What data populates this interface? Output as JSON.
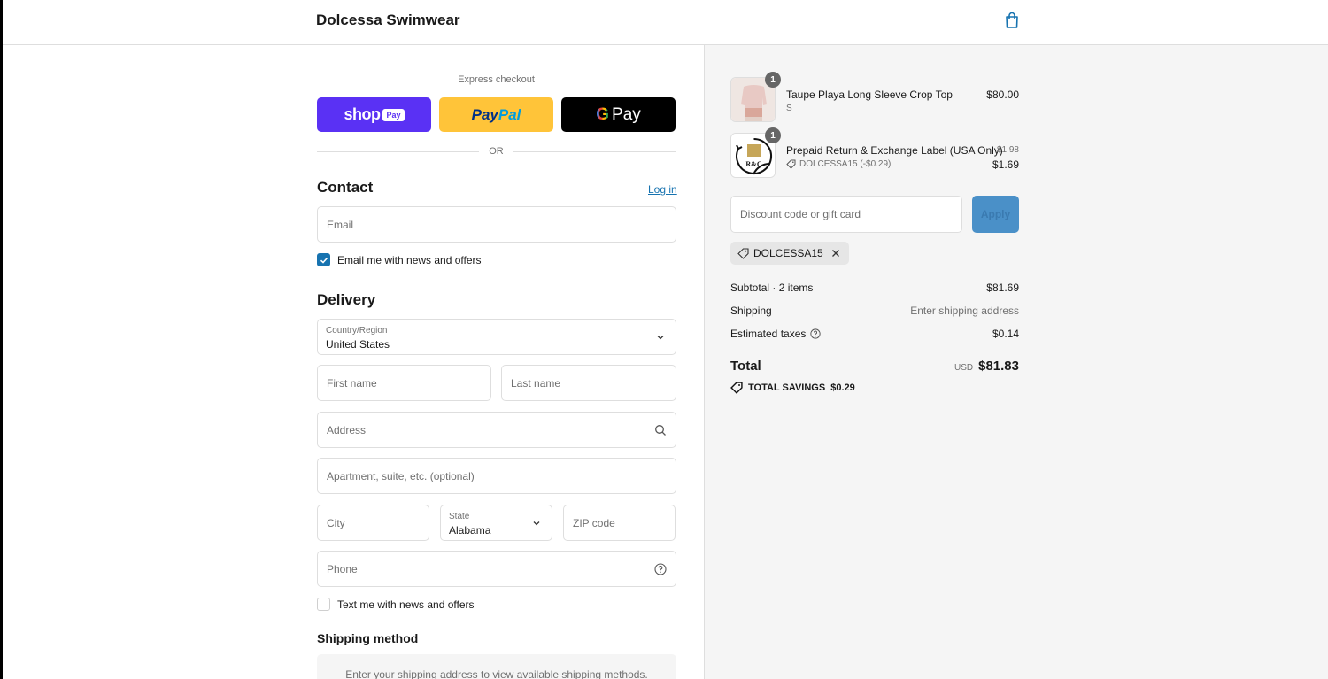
{
  "header": {
    "store_name": "Dolcessa Swimwear",
    "cart_icon": "shopping-bag-icon"
  },
  "express": {
    "label": "Express checkout",
    "shop_pay": {
      "word": "shop",
      "pill": "Pay"
    },
    "paypal": {
      "part1": "Pay",
      "part2": "Pal"
    },
    "gpay": {
      "g": "G",
      "word": "Pay"
    },
    "or_text": "OR"
  },
  "contact": {
    "title": "Contact",
    "login_link": "Log in",
    "email_placeholder": "Email",
    "news_checkbox_label": "Email me with news and offers",
    "news_checked": true
  },
  "delivery": {
    "title": "Delivery",
    "country_label": "Country/Region",
    "country_value": "United States",
    "first_name_placeholder": "First name",
    "last_name_placeholder": "Last name",
    "address_placeholder": "Address",
    "apartment_placeholder": "Apartment, suite, etc. (optional)",
    "city_placeholder": "City",
    "state_label": "State",
    "state_value": "Alabama",
    "zip_placeholder": "ZIP code",
    "phone_placeholder": "Phone",
    "text_checkbox_label": "Text me with news and offers",
    "text_checked": false
  },
  "shipping_method": {
    "title": "Shipping method",
    "message": "Enter your shipping address to view available shipping methods."
  },
  "summary": {
    "items": [
      {
        "name": "Taupe Playa Long Sleeve Crop Top",
        "variant": "S",
        "price": "$80.00",
        "qty": "1"
      },
      {
        "name": "Prepaid Return & Exchange Label (USA Only)",
        "discount": "DOLCESSA15 (-$0.29)",
        "old_price": "$1.98",
        "price": "$1.69",
        "qty": "1",
        "logo_text": "R&C"
      }
    ],
    "discount_placeholder": "Discount code or gift card",
    "apply_label": "Apply",
    "applied_code": "DOLCESSA15",
    "subtotal_label": "Subtotal · 2 items",
    "subtotal_value": "$81.69",
    "shipping_label": "Shipping",
    "shipping_value": "Enter shipping address",
    "taxes_label": "Estimated taxes",
    "taxes_value": "$0.14",
    "total_label": "Total",
    "currency": "USD",
    "total_value": "$81.83",
    "savings_label": "TOTAL SAVINGS",
    "savings_value": "$0.29"
  },
  "colors": {
    "accent": "#1773b0",
    "shop_pay": "#5a31f4",
    "paypal": "#ffc439",
    "gpay": "#000000",
    "summary_bg": "#f5f5f5"
  }
}
